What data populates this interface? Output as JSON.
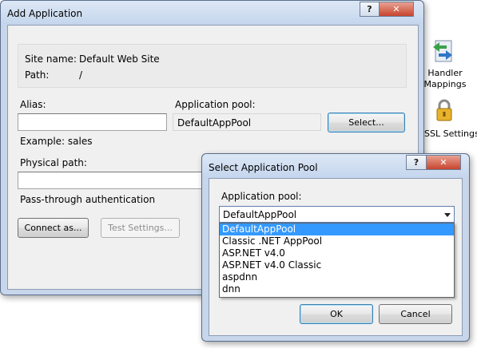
{
  "main_dialog": {
    "title": "Add Application",
    "help_button": "?",
    "close_button": "✕",
    "site_name_label": "Site name:",
    "site_name_value": "Default Web Site",
    "path_label": "Path:",
    "path_value": "/",
    "alias_label": "Alias:",
    "alias_value": "",
    "app_pool_label": "Application pool:",
    "app_pool_value": "DefaultAppPool",
    "select_button": "Select...",
    "example_text": "Example: sales",
    "physical_path_label": "Physical path:",
    "physical_path_value": "",
    "passthrough_label": "Pass-through authentication",
    "connect_as_button": "Connect as...",
    "test_settings_button": "Test Settings..."
  },
  "side_panel": {
    "handler_mappings_line1": "Handler",
    "handler_mappings_line2": "Mappings",
    "ssl_settings": "SSL Settings"
  },
  "pool_dialog": {
    "title": "Select Application Pool",
    "help_button": "?",
    "close_button": "✕",
    "app_pool_label": "Application pool:",
    "selected_value": "DefaultAppPool",
    "options": [
      "DefaultAppPool",
      "Classic .NET AppPool",
      "ASP.NET v4.0",
      "ASP.NET v4.0 Classic",
      "aspdnn",
      "dnn"
    ],
    "ok_button": "OK",
    "cancel_button": "Cancel"
  }
}
